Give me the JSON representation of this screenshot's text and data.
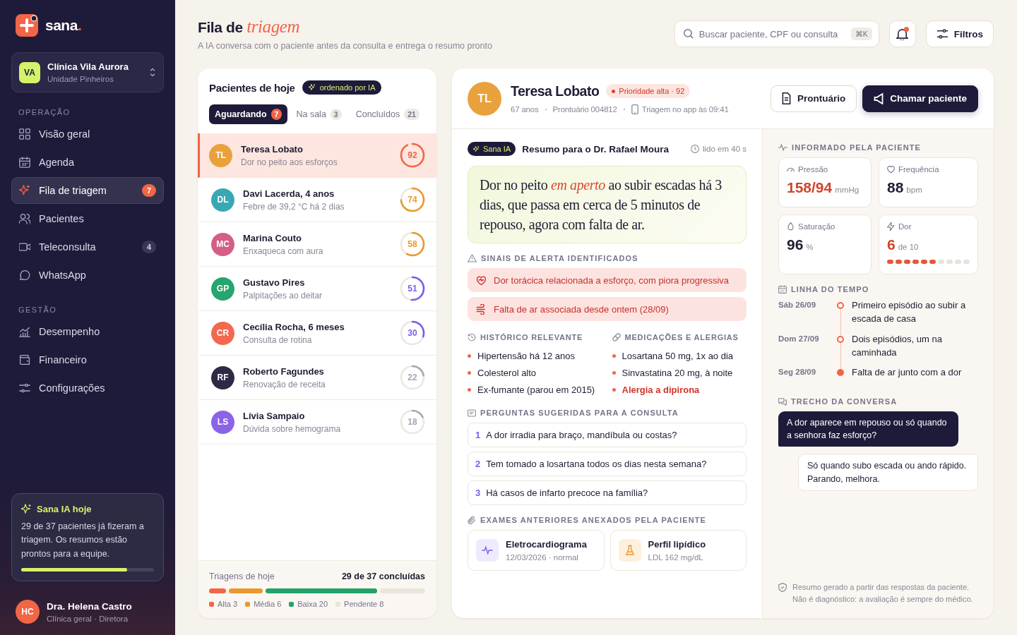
{
  "brand": {
    "name": "sana",
    "dot": "."
  },
  "clinic": {
    "initials": "VA",
    "name": "Clínica Vila Aurora",
    "unit": "Unidade Pinheiros"
  },
  "nav_sections": [
    {
      "title": "OPERAÇÃO",
      "items": [
        {
          "label": "Visão geral",
          "kind": "grid",
          "selected": false
        },
        {
          "label": "Agenda",
          "kind": "calendar",
          "selected": false
        },
        {
          "label": "Fila de triagem",
          "kind": "sparkle",
          "selected": true,
          "badge": "7"
        },
        {
          "label": "Pacientes",
          "kind": "users",
          "selected": false
        },
        {
          "label": "Teleconsulta",
          "kind": "video",
          "selected": false,
          "badge": "4"
        },
        {
          "label": "WhatsApp",
          "kind": "chat",
          "selected": false
        }
      ]
    },
    {
      "title": "GESTÃO",
      "items": [
        {
          "label": "Desempenho",
          "kind": "chart",
          "selected": false
        },
        {
          "label": "Financeiro",
          "kind": "wallet",
          "selected": false
        },
        {
          "label": "Configurações",
          "kind": "sliders",
          "selected": false
        }
      ]
    }
  ],
  "ai_card": {
    "title": "Sana IA hoje",
    "text": "29 de 37 pacientes já fizeram a triagem. Os resumos estão prontos para a equipe.",
    "level": 0.8
  },
  "user": {
    "initials": "HC",
    "name": "Dra. Helena Castro",
    "role": "Clínica geral · Diretora"
  },
  "header": {
    "title": "Fila de *triagem*",
    "subtitle": "A IA conversa com o paciente antes da consulta e entrega o resumo pronto",
    "search": {
      "placeholder": "Buscar paciente, CPF ou consulta",
      "shortcut": "⌘K"
    },
    "notifications_unread": true,
    "filter_button": "Filtros"
  },
  "queue": {
    "title": "Pacientes de hoje",
    "ai_badge": "ordenado por IA",
    "tabs": [
      {
        "label": "Aguardando",
        "count": "7",
        "selected": true
      },
      {
        "label": "Na sala",
        "count": "3",
        "selected": false
      },
      {
        "label": "Concluídos",
        "count": "21",
        "selected": false
      }
    ],
    "patients": [
      {
        "initials": "TL",
        "color": "#e9a23b",
        "name": "Teresa Lobato",
        "reason": "Dor no peito aos esforços",
        "score": "92",
        "kind": "high",
        "selected": true
      },
      {
        "initials": "DL",
        "color": "#3aa7b5",
        "name": "Davi Lacerda, 4 anos",
        "reason": "Febre de 39,2 °C há 2 dias",
        "score": "74",
        "kind": "medium",
        "selected": false
      },
      {
        "initials": "MC",
        "color": "#d45e86",
        "name": "Marina Couto",
        "reason": "Enxaqueca com aura",
        "score": "58",
        "kind": "medium",
        "selected": false
      },
      {
        "initials": "GP",
        "color": "#27a56e",
        "name": "Gustavo Pires",
        "reason": "Palpitações ao deitar",
        "score": "51",
        "kind": "low",
        "selected": false
      },
      {
        "initials": "CR",
        "color": "#f2694f",
        "name": "Cecília Rocha, 6 meses",
        "reason": "Consulta de rotina",
        "score": "30",
        "kind": "low",
        "selected": false
      },
      {
        "initials": "RF",
        "color": "#2c2a45",
        "name": "Roberto Fagundes",
        "reason": "Renovação de receita",
        "score": "22",
        "kind": "minimal",
        "selected": false
      },
      {
        "initials": "LS",
        "color": "#8a63e6",
        "name": "Lívia Sampaio",
        "reason": "Dúvida sobre hemograma",
        "score": "18",
        "kind": "minimal",
        "selected": false
      }
    ],
    "footer": {
      "label": "Triagens de hoje",
      "summary": "29 de 37 concluídas",
      "segments": [
        {
          "label": "Alta",
          "count": "3",
          "color": "#f26547"
        },
        {
          "label": "Média",
          "count": "6",
          "color": "#e9992f"
        },
        {
          "label": "Baixa",
          "count": "20",
          "color": "#23a26b"
        },
        {
          "label": "Pendente",
          "count": "8",
          "color": "#ebe4da"
        }
      ]
    }
  },
  "detail": {
    "patient": {
      "initials": "TL",
      "name": "Teresa Lobato",
      "priority": "Prioridade alta · 92",
      "age": "67 anos",
      "record": "Prontuário 004812",
      "triage": "Triagem no app às 09:41"
    },
    "actions": [
      {
        "label": "Prontuário",
        "kind": "secondary"
      },
      {
        "label": "Chamar paciente",
        "kind": "primary"
      }
    ],
    "summary": {
      "badge": "Sana IA",
      "title": "Resumo para o Dr. Rafael Moura",
      "read_time": "lido em 40 s",
      "text": "Dor no peito *em aperto* ao subir escadas há 3 dias, que passa em cerca de 5 minutos de repouso, agora com falta de ar."
    },
    "alerts": {
      "title": "SINAIS DE ALERTA IDENTIFICADOS",
      "items": [
        {
          "text": "Dor torácica relacionada a esforço, com piora progressiva",
          "kind": "heart"
        },
        {
          "text": "Falta de ar associada desde ontem (28/09)",
          "kind": "wind"
        }
      ]
    },
    "history": {
      "title": "HISTÓRICO RELEVANTE",
      "items": [
        {
          "text": "Hipertensão há 12 anos",
          "alert": false
        },
        {
          "text": "Colesterol alto",
          "alert": false
        },
        {
          "text": "Ex-fumante (parou em 2015)",
          "alert": false
        }
      ]
    },
    "medications": {
      "title": "MEDICAÇÕES E ALERGIAS",
      "items": [
        {
          "text": "Losartana 50 mg, 1x ao dia",
          "alert": false
        },
        {
          "text": "Sinvastatina 20 mg, à noite",
          "alert": false
        },
        {
          "text": "Alergia a dipirona",
          "alert": true
        }
      ]
    },
    "questions": {
      "title": "PERGUNTAS SUGERIDAS PARA A CONSULTA",
      "items": [
        {
          "number": "1",
          "text": "A dor irradia para braço, mandíbula ou costas?"
        },
        {
          "number": "2",
          "text": "Tem tomado a losartana todos os dias nesta semana?"
        },
        {
          "number": "3",
          "text": "Há casos de infarto precoce na família?"
        }
      ]
    },
    "exams": {
      "title": "EXAMES ANTERIORES ANEXADOS PELA PACIENTE",
      "items": [
        {
          "name": "Eletrocardiograma",
          "detail": "12/03/2026 · normal",
          "kind": "ecg"
        },
        {
          "name": "Perfil lipídico",
          "detail": "LDL 162 mg/dL",
          "kind": "lab"
        }
      ]
    },
    "vitals": {
      "title": "INFORMADO PELA PACIENTE",
      "items": [
        {
          "label": "Pressão",
          "value": "158/94",
          "unit": "mmHg",
          "kind": "gauge",
          "alert": true
        },
        {
          "label": "Frequência",
          "value": "88",
          "unit": "bpm",
          "kind": "heart",
          "alert": false
        },
        {
          "label": "Saturação",
          "value": "96",
          "unit": "%",
          "kind": "drop",
          "alert": false
        },
        {
          "label": "Dor",
          "value": "6",
          "unit": "de 10",
          "kind": "bolt",
          "alert": true,
          "stars": 6
        }
      ]
    },
    "timeline": {
      "title": "LINHA DO TEMPO",
      "events": [
        {
          "date": "Sáb 26/09",
          "text": "Primeiro episódio ao subir a escada de casa",
          "current": false
        },
        {
          "date": "Dom 27/09",
          "text": "Dois episódios, um na caminhada",
          "current": false
        },
        {
          "date": "Seg 28/09",
          "text": "Falta de ar junto com a dor",
          "current": true
        }
      ]
    },
    "conversation": {
      "title": "TRECHO DA CONVERSA",
      "messages": [
        {
          "kind": "question",
          "text": "A dor aparece em repouso ou só quando a senhora faz esforço?"
        },
        {
          "kind": "answer",
          "text": "Só quando subo escada ou ando rápido. Parando, melhora."
        }
      ]
    },
    "disclaimer": "Resumo gerado a partir das respostas da paciente. Não é diagnóstico: a avaliação é sempre do médico."
  }
}
